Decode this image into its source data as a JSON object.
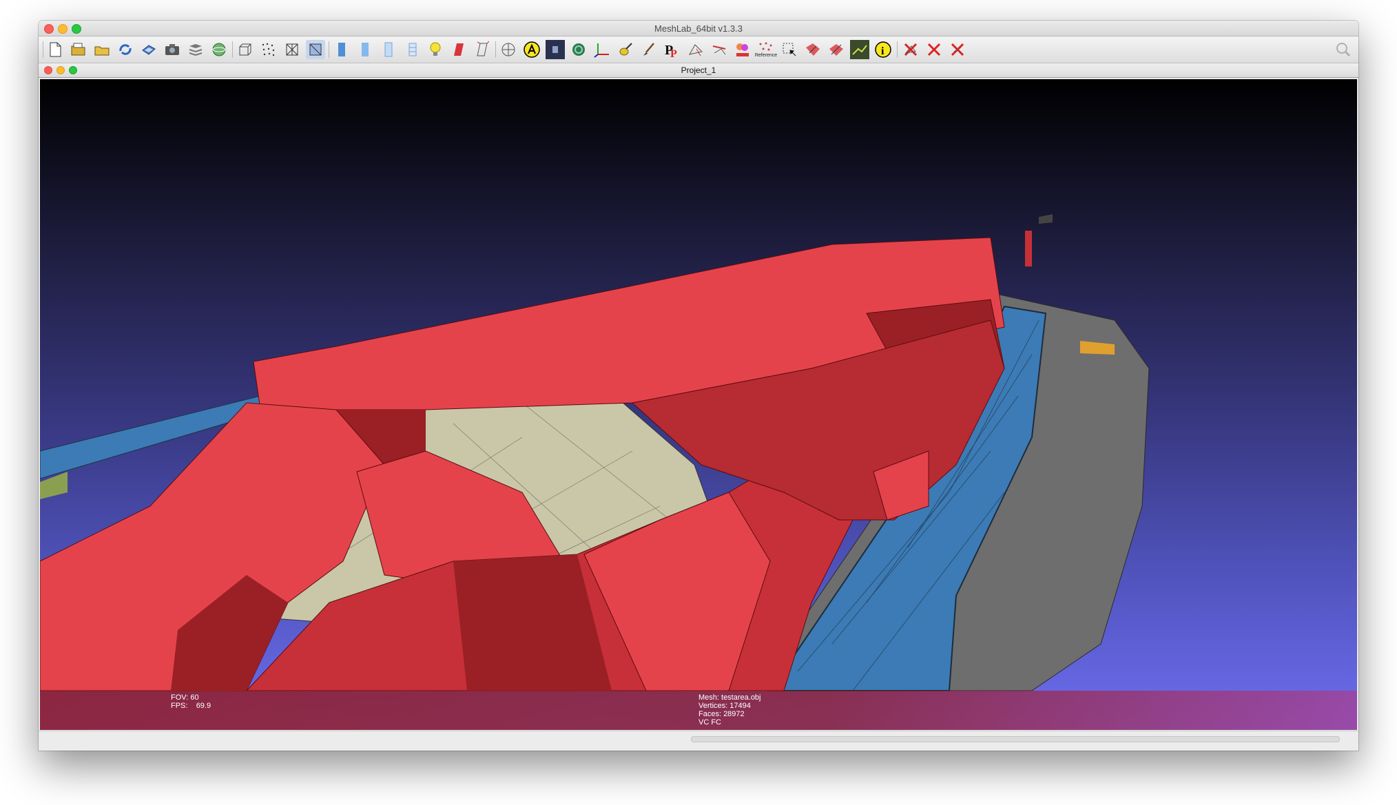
{
  "window": {
    "title": "MeshLab_64bit v1.3.3"
  },
  "document": {
    "title": "Project_1"
  },
  "toolbar": {
    "icons": [
      "new-file-icon",
      "open-folder-icon",
      "open-project-icon",
      "reload-icon",
      "save-icon",
      "snapshot-icon",
      "layers-icon",
      "sphere-icon",
      "bounding-box-icon",
      "points-icon",
      "wireframe-icon",
      "hidden-lines-icon",
      "flat-lines-icon",
      "flat-icon",
      "smooth-icon",
      "texture-icon",
      "light-icon",
      "color-icon",
      "vertex-normals-icon",
      "trackball-icon",
      "annotation-icon",
      "picture-icon",
      "color-wheel-icon",
      "axes-icon",
      "paint-icon",
      "brush-icon",
      "point-picker-icon",
      "select-faces-icon",
      "select-vertices-icon",
      "color-map-icon",
      "reference-icon",
      "select-area-icon",
      "measure-icon",
      "align-icon",
      "raster-icon",
      "info-icon",
      "delete-faces-icon",
      "delete-vertices-icon",
      "delete-selection-icon"
    ],
    "reference_label": "Reference"
  },
  "viewer": {
    "fov_label": "FOV:",
    "fov_value": "60",
    "fps_label": "FPS:",
    "fps_value": "69.9",
    "mesh_line": "Mesh: testarea.obj",
    "vertices_line": "Vertices: 17494",
    "faces_line": "Faces: 28972",
    "color_line": "VC FC"
  },
  "colors": {
    "building": "#e5434b",
    "building_shadow": "#9a2025",
    "water": "#3c7bb5",
    "ground": "#6e6e6e",
    "terrain": "#c9c7a8",
    "background_top": "#000000",
    "background_bottom": "#6d6ef0"
  }
}
